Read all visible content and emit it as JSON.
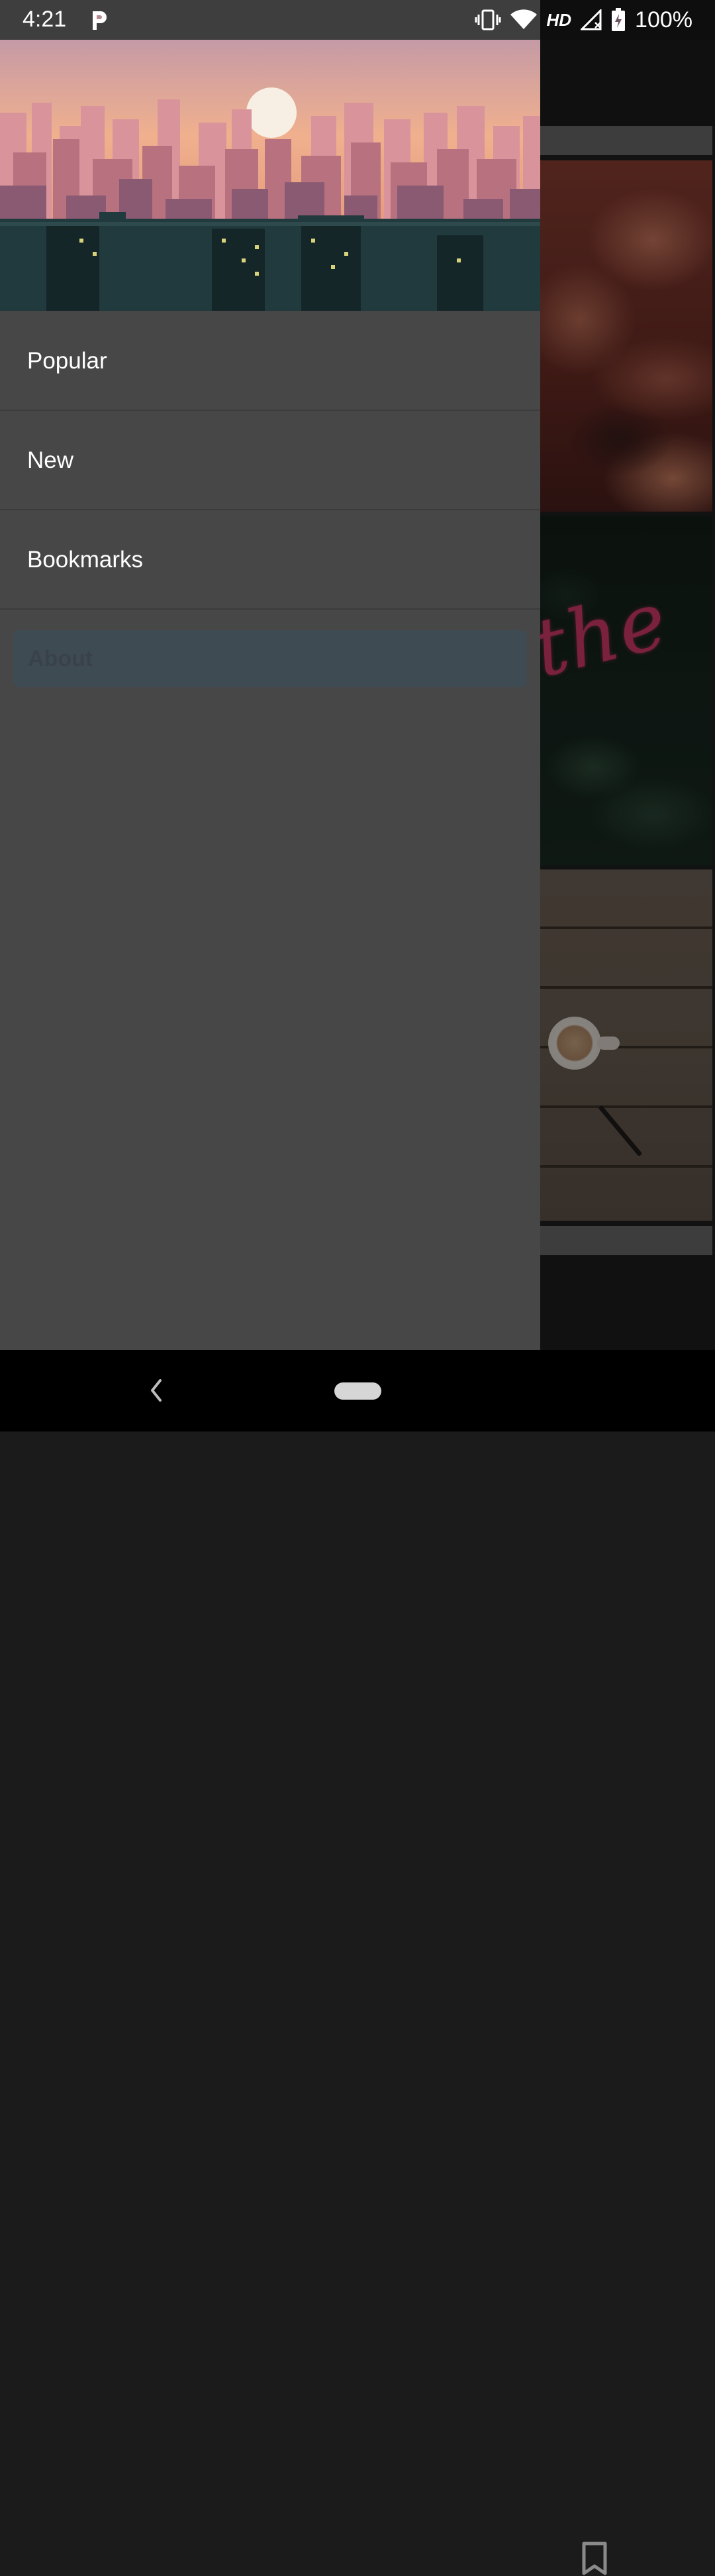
{
  "status_bar": {
    "time": "4:21",
    "network_label": "HD",
    "battery_percent": "100%",
    "icons": [
      "parking-app-icon",
      "vibrate-icon",
      "wifi-icon",
      "signal-icon",
      "battery-charging-icon"
    ]
  },
  "drawer": {
    "items": [
      {
        "label": "Popular"
      },
      {
        "label": "New"
      },
      {
        "label": "Bookmarks"
      },
      {
        "label": "About"
      }
    ],
    "selected_index": 3,
    "header_image": "pixel-art-city-skyline-sunset"
  },
  "background": {
    "bottom_icon": "bookmark-icon",
    "tiles": [
      "clouds-photo",
      "neon-sign-plants-photo",
      "coffee-wood-table-photo"
    ],
    "neon_text": "the"
  },
  "nav_bar": {
    "icons": [
      "back-icon",
      "home-pill"
    ]
  },
  "colors": {
    "drawer_bg": "#474747",
    "selected_bg": "#3f4b53",
    "scrim": "rgba(0,0,0,0.42)"
  }
}
